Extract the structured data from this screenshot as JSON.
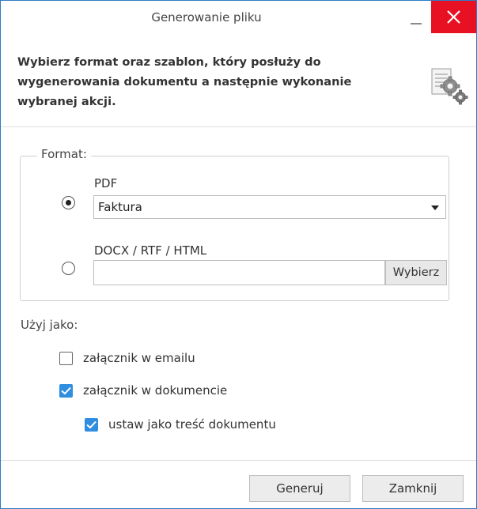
{
  "window": {
    "title": "Generowanie pliku"
  },
  "header": {
    "instruction": "Wybierz format oraz szablon, który posłuży do wygenerowania dokumentu a następnie wykonanie wybranej akcji."
  },
  "format": {
    "legend": "Format:",
    "pdf": {
      "label": "PDF",
      "selected": true,
      "template_value": "Faktura"
    },
    "docx": {
      "label": "DOCX / RTF / HTML",
      "selected": false,
      "file_value": "",
      "browse_label": "Wybierz"
    }
  },
  "use_as": {
    "label": "Użyj jako:",
    "options": [
      {
        "label": "załącznik w emailu",
        "checked": false
      },
      {
        "label": "załącznik w dokumencie",
        "checked": true
      },
      {
        "label": "ustaw jako treść dokumentu",
        "checked": true
      }
    ]
  },
  "footer": {
    "generate_label": "Generuj",
    "close_label": "Zamknij"
  },
  "colors": {
    "accent": "#2f8ee0",
    "close": "#e81123",
    "border": "#2d7bc2"
  }
}
